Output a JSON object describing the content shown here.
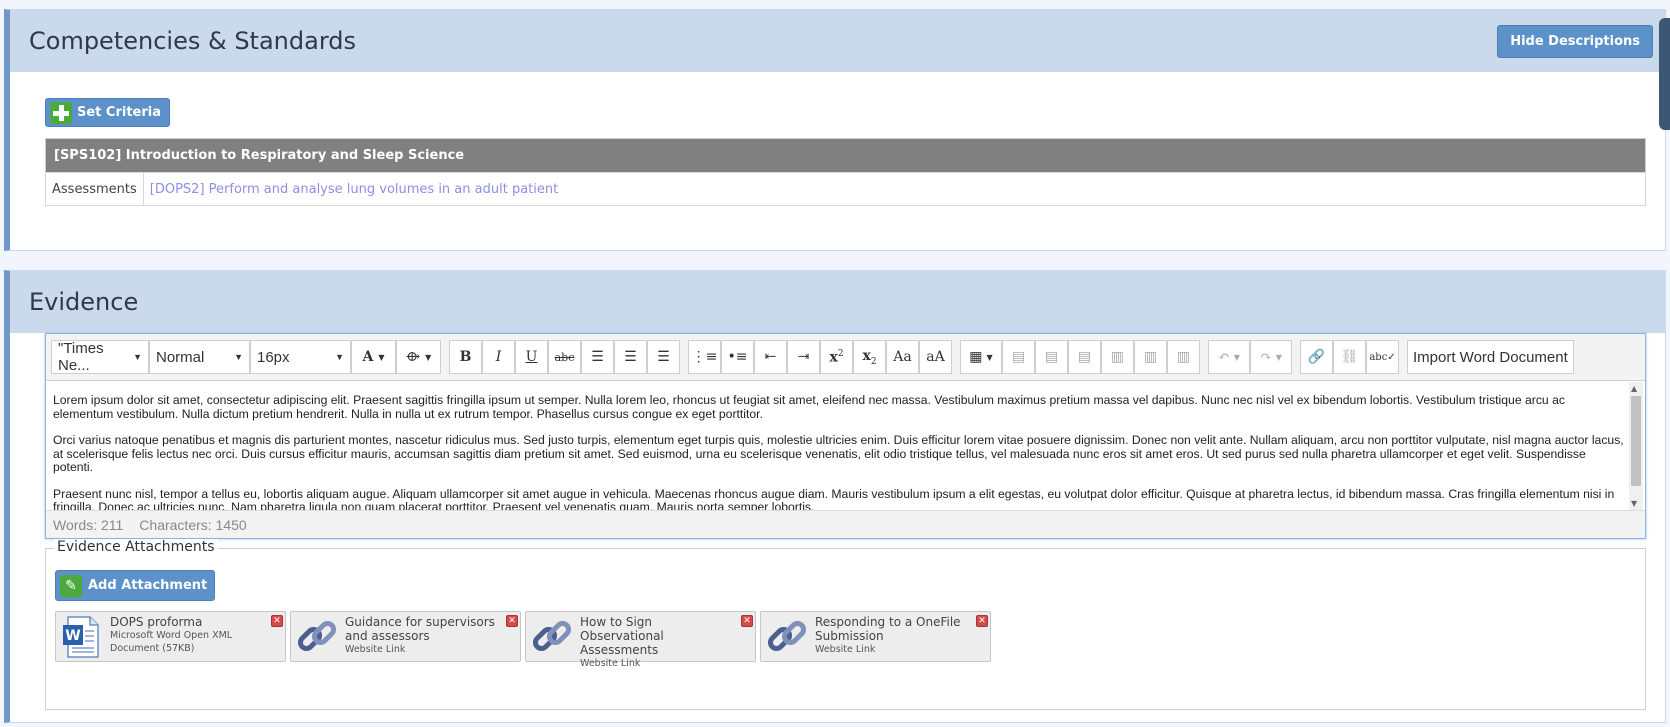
{
  "competencies": {
    "title": "Competencies & Standards",
    "hide_button": "Hide Descriptions",
    "set_criteria": "Set Criteria",
    "standard_header": "[SPS102] Introduction to Respiratory and Sleep Science",
    "row_label": "Assessments",
    "row_link": "[DOPS2] Perform and analyse lung volumes in an adult patient"
  },
  "evidence": {
    "title": "Evidence",
    "toolbar": {
      "font_family": "\"Times Ne...",
      "format": "Normal",
      "font_size": "16px",
      "import_button": "Import Word Document"
    },
    "paragraphs": [
      "Lorem ipsum dolor sit amet, consectetur adipiscing elit. Praesent sagittis fringilla ipsum ut semper. Nulla lorem leo, rhoncus ut feugiat sit amet, eleifend nec massa. Vestibulum maximus pretium massa vel dapibus. Nunc nec nisl vel ex bibendum lobortis. Vestibulum tristique arcu ac elementum vestibulum. Nulla dictum pretium hendrerit. Nulla in nulla ut ex rutrum tempor. Phasellus cursus congue ex eget porttitor.",
      "Orci varius natoque penatibus et magnis dis parturient montes, nascetur ridiculus mus. Sed justo turpis, elementum eget turpis quis, molestie ultricies enim. Duis efficitur lorem vitae posuere dignissim. Donec non velit ante. Nullam aliquam, arcu non porttitor vulputate, nisl magna auctor lacus, at scelerisque felis lectus nec orci. Duis cursus efficitur mauris, accumsan sagittis diam pretium sit amet. Sed euismod, urna eu scelerisque venenatis, elit odio tristique tellus, vel malesuada nunc eros sit amet eros. Ut sed purus sed nulla pharetra ullamcorper et eget velit. Suspendisse potenti.",
      "Praesent nunc nisl, tempor a tellus eu, lobortis aliquam augue. Aliquam ullamcorper sit amet augue in vehicula. Maecenas rhoncus augue diam. Mauris vestibulum ipsum a elit egestas, eu volutpat dolor efficitur. Quisque at pharetra lectus, id bibendum massa. Cras fringilla elementum nisi in fringilla. Donec ac ultricies nunc. Nam pharetra ligula non quam placerat porttitor. Praesent vel venenatis quam. Mauris porta semper lobortis."
    ],
    "status": {
      "words": "Words: 211",
      "characters": "Characters: 1450"
    },
    "attachments": {
      "legend": "Evidence Attachments",
      "add_button": "Add Attachment",
      "items": [
        {
          "title": "DOPS proforma",
          "meta": "Microsoft Word Open XML Document (57KB)",
          "icon": "word-document-icon"
        },
        {
          "title": "Guidance for supervisors and assessors",
          "meta": "Website Link",
          "icon": "link-icon"
        },
        {
          "title": "How to Sign Observational Assessments",
          "meta": "Website Link",
          "icon": "link-icon"
        },
        {
          "title": "Responding to a OneFile Submission",
          "meta": "Website Link",
          "icon": "link-icon"
        }
      ]
    }
  }
}
